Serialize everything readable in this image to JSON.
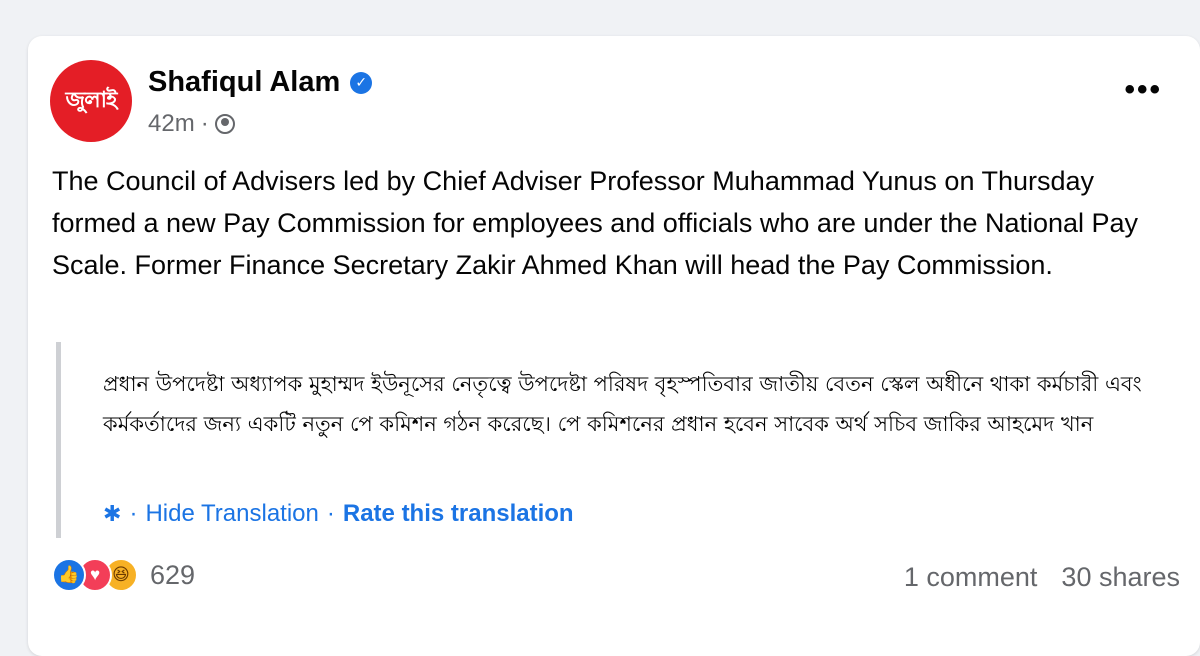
{
  "post": {
    "avatar_text": "জুলাই",
    "author": "Shafiqul Alam",
    "time": "42m",
    "meta_sep": "·",
    "more_label": "•••",
    "body": "The Council of Advisers led by Chief Adviser Professor Muhammad Yunus on Thursday formed a new Pay Commission for employees and officials who are under the National Pay Scale. Former Finance Secretary Zakir Ahmed Khan will head the Pay Commission.",
    "original_text": "প্রধান উপদেষ্টা অধ্যাপক মুহাম্মদ ইউনূসের নেতৃত্বে উপদেষ্টা পরিষদ বৃহস্পতিবার জাতীয় বেতন স্কেল অধীনে থাকা কর্মচারী এবং কর্মকর্তাদের জন্য একটি নতুন পে কমিশন গঠন করেছে। পে কমিশনের প্রধান হবেন সাবেক অর্থ সচিব জাকির আহমেদ খান",
    "hide_translation": "Hide Translation",
    "link_sep": "·",
    "rate_translation": "Rate this translation"
  },
  "footer": {
    "reaction_count": "629",
    "comments": "1 comment",
    "shares": "30 shares"
  },
  "icons": {
    "verified": "verified-badge-icon",
    "privacy": "globe-icon",
    "translate_settings": "gear-icon",
    "reactions": [
      "like-icon",
      "love-icon",
      "haha-icon"
    ]
  },
  "colors": {
    "accent": "#1b74e4",
    "avatar_bg": "#e41e26",
    "secondary_text": "#65676b"
  }
}
